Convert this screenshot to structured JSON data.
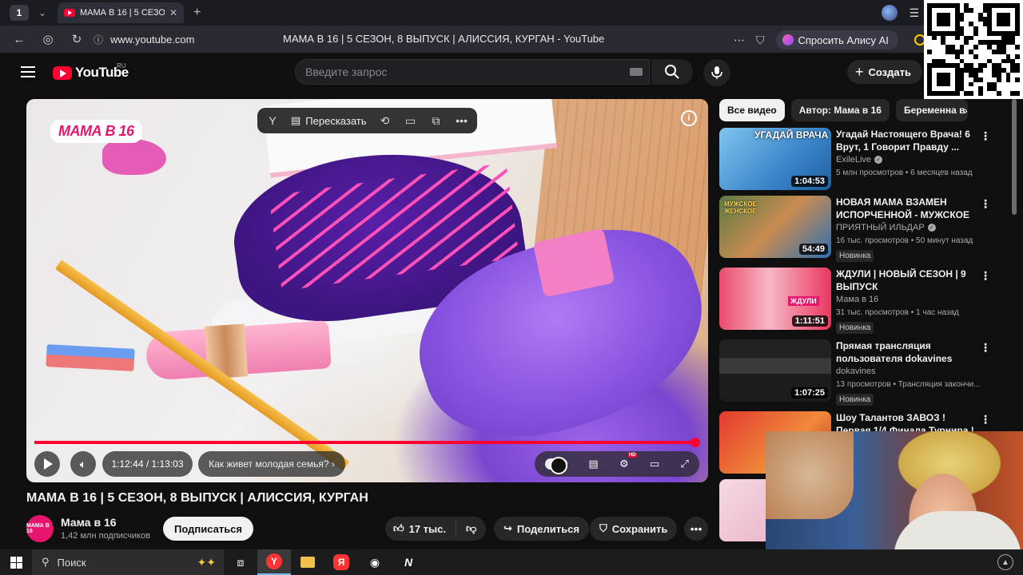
{
  "browser": {
    "tab_count": "1",
    "tab_title": "МАМА В 16 | 5 СЕЗОН,",
    "url": "www.youtube.com",
    "page_title": "МАМА В 16 | 5 СЕЗОН, 8 ВЫПУСК | АЛИССИЯ, КУРГАН - YouTube",
    "alice_label": "Спросить Алису AI"
  },
  "header": {
    "logo_text": "YouTube",
    "region": "RU",
    "search_placeholder": "Введите запрос",
    "create_label": "Создать"
  },
  "player": {
    "brand_badge": "МАМА В 16",
    "retell_label": "Пересказать",
    "time": "1:12:44 / 1:13:03",
    "chapter": "Как живет молодая семья?",
    "progress": 0.996,
    "hd_badge": "HD"
  },
  "video": {
    "title": "МАМА В 16 | 5 СЕЗОН, 8 ВЫПУСК | АЛИССИЯ, КУРГАН",
    "channel": "Мама в 16",
    "channel_avatar": "МАМА В 16",
    "subscribers": "1,42 млн подписчиков",
    "subscribe_label": "Подписаться",
    "likes": "17 тыс.",
    "share_label": "Поделиться",
    "save_label": "Сохранить"
  },
  "sidebar": {
    "chips": [
      "Все видео",
      "Автор: Мама в 16",
      "Беременна в"
    ],
    "recommendations": [
      {
        "title": "Угадай Настоящего Врача! 6 Врут, 1 Говорит Правду ...",
        "channel": "ExileLive",
        "verified": true,
        "meta": "5 млн просмотров • 6 месяцев назад",
        "duration": "1:04:53",
        "badge": "",
        "thumb_text": "УГАДАЙ ВРАЧА"
      },
      {
        "title": "НОВАЯ МАМА ВЗАМЕН ИСПОРЧЕННОЙ - МУЖСКОЕ ...",
        "channel": "ПРИЯТНЫЙ ИЛЬДАР",
        "verified": true,
        "meta": "16 тыс. просмотров • 50 минут назад",
        "duration": "54:49",
        "badge": "Новинка",
        "thumb_text": "МУЖСКОЕ ЖЕНСКОЕ"
      },
      {
        "title": "ЖДУЛИ | НОВЫЙ СЕЗОН | 9 ВЫПУСК",
        "channel": "Мама в 16",
        "verified": false,
        "meta": "31 тыс. просмотров • 1 час назад",
        "duration": "1:11:51",
        "badge": "Новинка",
        "thumb_text": "ЖДУЛИ"
      },
      {
        "title": "Прямая трансляция пользователя dokavines",
        "channel": "dokavines",
        "verified": false,
        "meta": "13 просмотров • Трансляция закончи...",
        "duration": "1:07:25",
        "badge": "Новинка",
        "thumb_text": ""
      },
      {
        "title": "Шоу Талантов ЗАВОЗ ! Первая 1/4 Финала Турнира !",
        "channel": "",
        "verified": false,
        "meta": "",
        "duration": "",
        "badge": "",
        "thumb_text": ""
      }
    ]
  },
  "taskbar": {
    "search_label": "Поиск"
  },
  "colors": {
    "yt_red": "#ff0033",
    "bg": "#0f0f0f",
    "brand_pink": "#e8156f"
  }
}
